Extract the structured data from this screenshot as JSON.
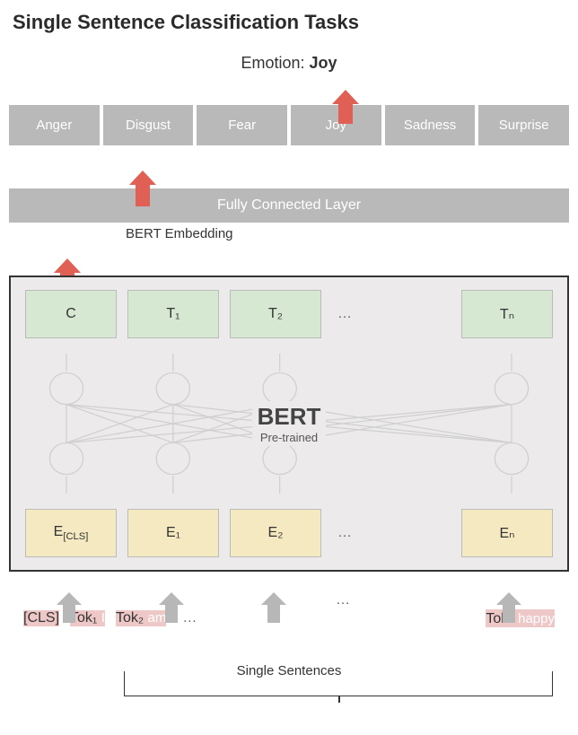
{
  "title": "Single Sentence Classification Tasks",
  "output": {
    "label": "Emotion:",
    "value": "Joy"
  },
  "emotions": [
    "Anger",
    "Disgust",
    "Fear",
    "Joy",
    "Sadness",
    "Surprise"
  ],
  "fc_layer": "Fully Connected Layer",
  "bert_embedding_label": "BERT Embedding",
  "bert": {
    "name": "BERT",
    "sub": "Pre-trained"
  },
  "out_blocks": [
    "C",
    "T₁",
    "T₂",
    "Tₙ"
  ],
  "in_blocks": [
    "E[CLS]",
    "E₁",
    "E₂",
    "Eₙ"
  ],
  "ellipsis": "…",
  "tokens": [
    {
      "top": "[CLS]",
      "bottom": ""
    },
    {
      "top": "Tok₁",
      "bottom": "I"
    },
    {
      "top": "Tok₂",
      "bottom": "am"
    },
    {
      "top": "Tokₙ",
      "bottom": "happy"
    }
  ],
  "single_sentences": "Single Sentences",
  "chart_data": {
    "type": "diagram",
    "note": "BERT single-sentence classification architecture; input tokens go through pre-trained BERT, [CLS] output C feeds FC layer producing emotion logits; example output Joy."
  }
}
